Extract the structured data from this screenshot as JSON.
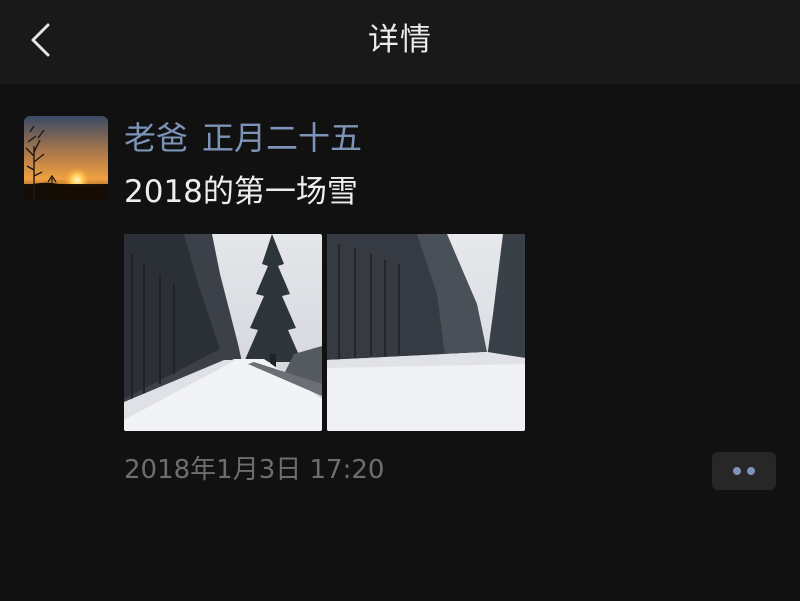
{
  "nav": {
    "title": "详情",
    "back_icon": "chevron-left-icon"
  },
  "post": {
    "author": "老爸",
    "author_note": "正月二十五",
    "text": "2018的第一场雪",
    "photos": [
      {
        "subject": "snowy road through tall evergreen trees"
      },
      {
        "subject": "snow-covered field before a line of evergreen trees"
      }
    ],
    "timestamp": "2018年1月3日 17:20",
    "more_icon": "more-dots-icon"
  },
  "colors": {
    "background": "#111111",
    "nav_background": "#191919",
    "author_link": "#7d93b8",
    "body_text": "#eeeeee",
    "timestamp": "#6e6e6e",
    "more_button_bg": "#272727"
  }
}
